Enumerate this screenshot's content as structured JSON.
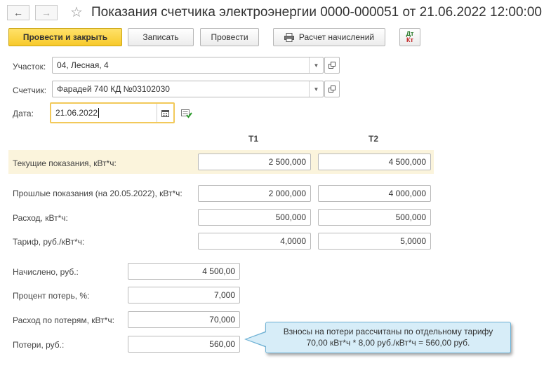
{
  "header": {
    "back_icon": "arrow-left-icon",
    "forward_icon": "arrow-right-icon",
    "favorite_icon": "star-icon",
    "title": "Показания счетчика электроэнергии 0000-000051 от 21.06.2022 12:00:00"
  },
  "toolbar": {
    "post_close_label": "Провести и закрыть",
    "save_label": "Записать",
    "post_label": "Провести",
    "calc_label": "Расчет начислений",
    "calc_icon": "printer-icon",
    "dtkt_icon": "dt-kt-icon",
    "dt_text": "Дт",
    "kt_text": "Кт"
  },
  "form": {
    "uchastok": {
      "label": "Участок:",
      "value": "04, Лесная, 4"
    },
    "schetchik": {
      "label": "Счетчик:",
      "value": "Фарадей 740 КД №03102030"
    },
    "data": {
      "label": "Дата:",
      "value": "21.06.2022"
    }
  },
  "columns": {
    "t1": "Т1",
    "t2": "Т2"
  },
  "readings": [
    {
      "label": "Текущие показания, кВт*ч:",
      "t1": "2 500,000",
      "t2": "4 500,000"
    },
    {
      "label": "Прошлые показания (на 20.05.2022), кВт*ч:",
      "t1": "2 000,000",
      "t2": "4 000,000"
    },
    {
      "label": "Расход, кВт*ч:",
      "t1": "500,000",
      "t2": "500,000"
    },
    {
      "label": "Тариф, руб./кВт*ч:",
      "t1": "4,0000",
      "t2": "5,0000"
    }
  ],
  "totals": [
    {
      "label": "Начислено, руб.:",
      "value": "4 500,00"
    },
    {
      "label": "Процент потерь, %:",
      "value": "7,000"
    },
    {
      "label": "Расход по потерям, кВт*ч:",
      "value": "70,000"
    },
    {
      "label": "Потери, руб.:",
      "value": "560,00"
    }
  ],
  "callout": {
    "line1": "Взносы на потери рассчитаны по отдельному тарифу",
    "line2": "70,00 кВт*ч * 8,00 руб./кВт*ч = 560,00 руб."
  },
  "colors": {
    "accent": "#f7c92a",
    "highlight": "#fbf4dc",
    "callout_bg": "#d7edf8"
  }
}
